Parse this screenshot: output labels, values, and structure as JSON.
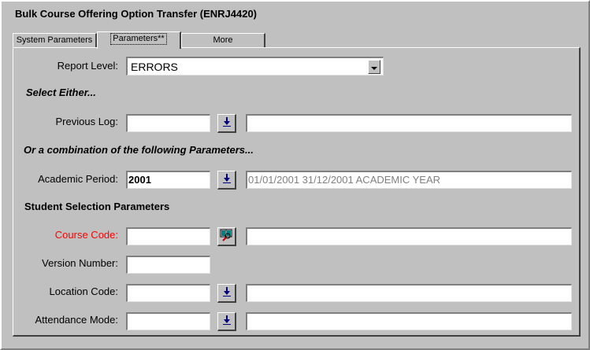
{
  "window": {
    "title": "Bulk Course Offering Option Transfer (ENRJ4420)"
  },
  "tabs": [
    {
      "label": "System Parameters"
    },
    {
      "label": "Parameters**"
    },
    {
      "label": "More"
    }
  ],
  "form": {
    "report_level": {
      "label": "Report Level:",
      "value": "ERRORS"
    },
    "select_either": "Select Either...",
    "previous_log": {
      "label": "Previous Log:",
      "value": "",
      "description": ""
    },
    "combination_heading": "Or a combination of the following Parameters...",
    "academic_period": {
      "label": "Academic Period:",
      "value": "2001",
      "description": "01/01/2001 31/12/2001 ACADEMIC YEAR"
    },
    "student_selection_heading": "Student Selection Parameters",
    "course_code": {
      "label": "Course Code:",
      "value": "",
      "description": "",
      "label_color": "#ff0000"
    },
    "version_number": {
      "label": "Version Number:",
      "value": ""
    },
    "location_code": {
      "label": "Location Code:",
      "value": "",
      "description": ""
    },
    "attendance_mode": {
      "label": "Attendance Mode:",
      "value": "",
      "description": ""
    }
  },
  "icons": {
    "lookup": "down-arrow-lookup-icon",
    "course_search": "book-search-icon",
    "dropdown": "dropdown-arrow-icon"
  },
  "colors": {
    "background": "#c0c0c0",
    "lookup_arrow": "#000080",
    "required_label": "#ff0000"
  }
}
